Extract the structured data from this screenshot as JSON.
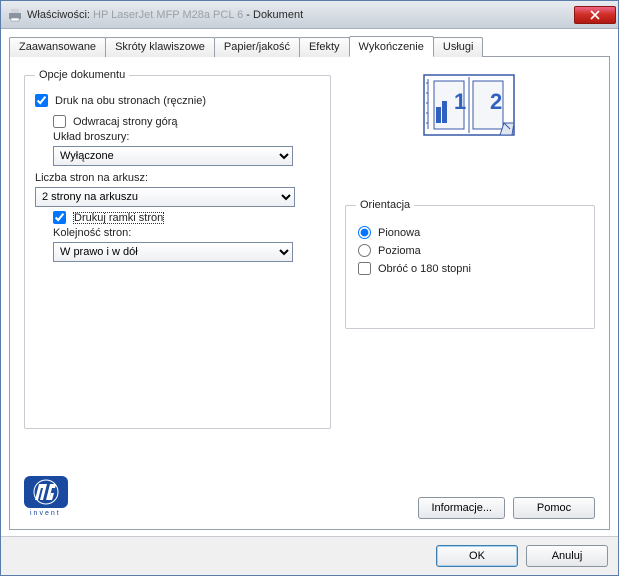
{
  "titlebar": {
    "prefix": "Właściwości:",
    "device": "HP LaserJet MFP M28a PCL 6",
    "suffix": "- Dokument"
  },
  "tabs": [
    {
      "label": "Zaawansowane",
      "active": false
    },
    {
      "label": "Skróty klawiszowe",
      "active": false
    },
    {
      "label": "Papier/jakość",
      "active": false
    },
    {
      "label": "Efekty",
      "active": false
    },
    {
      "label": "Wykończenie",
      "active": true
    },
    {
      "label": "Usługi",
      "active": false
    }
  ],
  "doc_options": {
    "legend": "Opcje dokumentu",
    "print_both_label": "Druk na obu stronach (ręcznie)",
    "print_both_checked": true,
    "flip_up_label": "Odwracaj strony górą",
    "flip_up_checked": false,
    "booklet_label": "Układ broszury:",
    "booklet_value": "Wyłączone",
    "pages_per_sheet_label": "Liczba stron na arkusz:",
    "pages_per_sheet_value": "2 strony na arkuszu",
    "frames_label": "Drukuj ramki stron",
    "frames_checked": true,
    "page_order_label": "Kolejność stron:",
    "page_order_value": "W prawo i w dół"
  },
  "orientation": {
    "legend": "Orientacja",
    "portrait_label": "Pionowa",
    "landscape_label": "Pozioma",
    "selected": "portrait",
    "rotate_label": "Obróć o 180 stopni",
    "rotate_checked": false
  },
  "buttons": {
    "info": "Informacje...",
    "help": "Pomoc",
    "ok": "OK",
    "cancel": "Anuluj"
  },
  "logo": {
    "subtext": "invent"
  }
}
